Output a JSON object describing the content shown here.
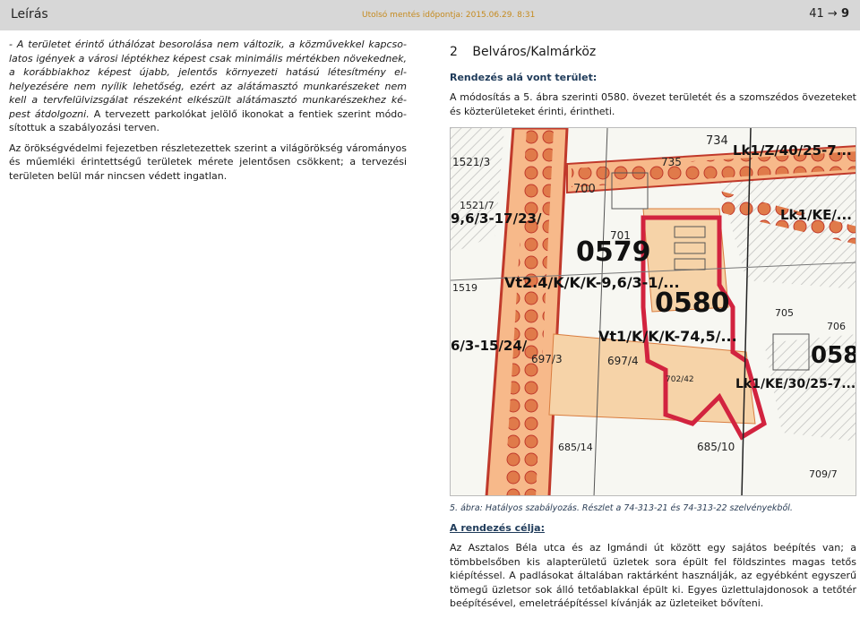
{
  "header": {
    "title": "Leírás",
    "saved": "Utolsó mentés időpontja: 2015.06.29. 8:31",
    "page_prefix": "41 →",
    "page_current": "9"
  },
  "left": {
    "p1a": "- A területet érintő úthálózat besorolása nem változik, a közművekkel kapcso­latos igények a városi léptékhez képest csak minimális mértékben növeked­nek, a korábbiakhoz képest újabb, jelentős környezeti hatású létesítmény el­helyezésére nem nyílik lehetőség, ezért az alátámasztó munkarészeket nem kell a tervfelülvizsgálat részeként elkészült alátámasztó munkarészekhez ké­pest átdolgozni.",
    "p1b": " A tervezett parkolókat jelölő ikonokat a fentiek szerint módo­sítottuk a szabályozási terven.",
    "p2": "Az örökségvédelmi fejezetben részletezettek szerint a világörökség váromá­nyos és műemléki érintettségű területek mérete jelentősen csökkent; a terve­zési területen belül már nincsen védett ingatlan."
  },
  "right": {
    "section_number": "2",
    "section_title": "Belváros/Kalmárköz",
    "subheading": "Rendezés alá vont terület:",
    "scope_text": "A módosítás a 5. ábra szerinti 0580. övezet területét és a szomszédos öveze­teket és közterületeket érinti, érintheti.",
    "caption": "5. ábra: Hatályos szabályozás. Részlet a 74-313-21 és 74-313-22 szelvényekből.",
    "goal_heading": "A rendezés célja:",
    "goal_text": "Az Asztalos Béla utca és az Igmándi út között egy sajátos beépítés van; a tömbbelsőben kis alapterületű üzletek sora épült fel földszintes magas tetős kiépítéssel. A padlásokat általában raktárként használják, az egyébként egy­szerű tömegű üzletsor sok álló tetőablakkal épült ki. Egyes üzlettulajdonosok a tetőtér beépítésével, emeletráépítéssel kívánják az üzleteiket bővíteni."
  },
  "map": {
    "labels": {
      "z0579": "0579",
      "z0580": "0580",
      "z058": "058",
      "code_vt24": "Vt2.4/K/K/K-9,6/3-1/...",
      "code_vt1": "Vt1/K/K/K-74,5/...",
      "code_lk1": "Lk1/Z/40/25-7...",
      "code_lk1ke": "Lk1/KE/...",
      "code_lk30": "Lk1/KE/30/25-7...",
      "code_left1": "9,6/3-17/23/",
      "code_left2": "6/3-15/24/",
      "p734": "734",
      "p735": "735",
      "p700": "700",
      "p701": "701",
      "p1521_3": "1521/3",
      "p1521_7": "1521/7",
      "p1519": "1519",
      "p697_3": "697/3",
      "p697_4": "697/4",
      "p702_42": "702/42",
      "p685_10": "685/10",
      "p685_14": "685/14",
      "p705": "705",
      "p706": "706",
      "p709_7": "709/7"
    }
  }
}
